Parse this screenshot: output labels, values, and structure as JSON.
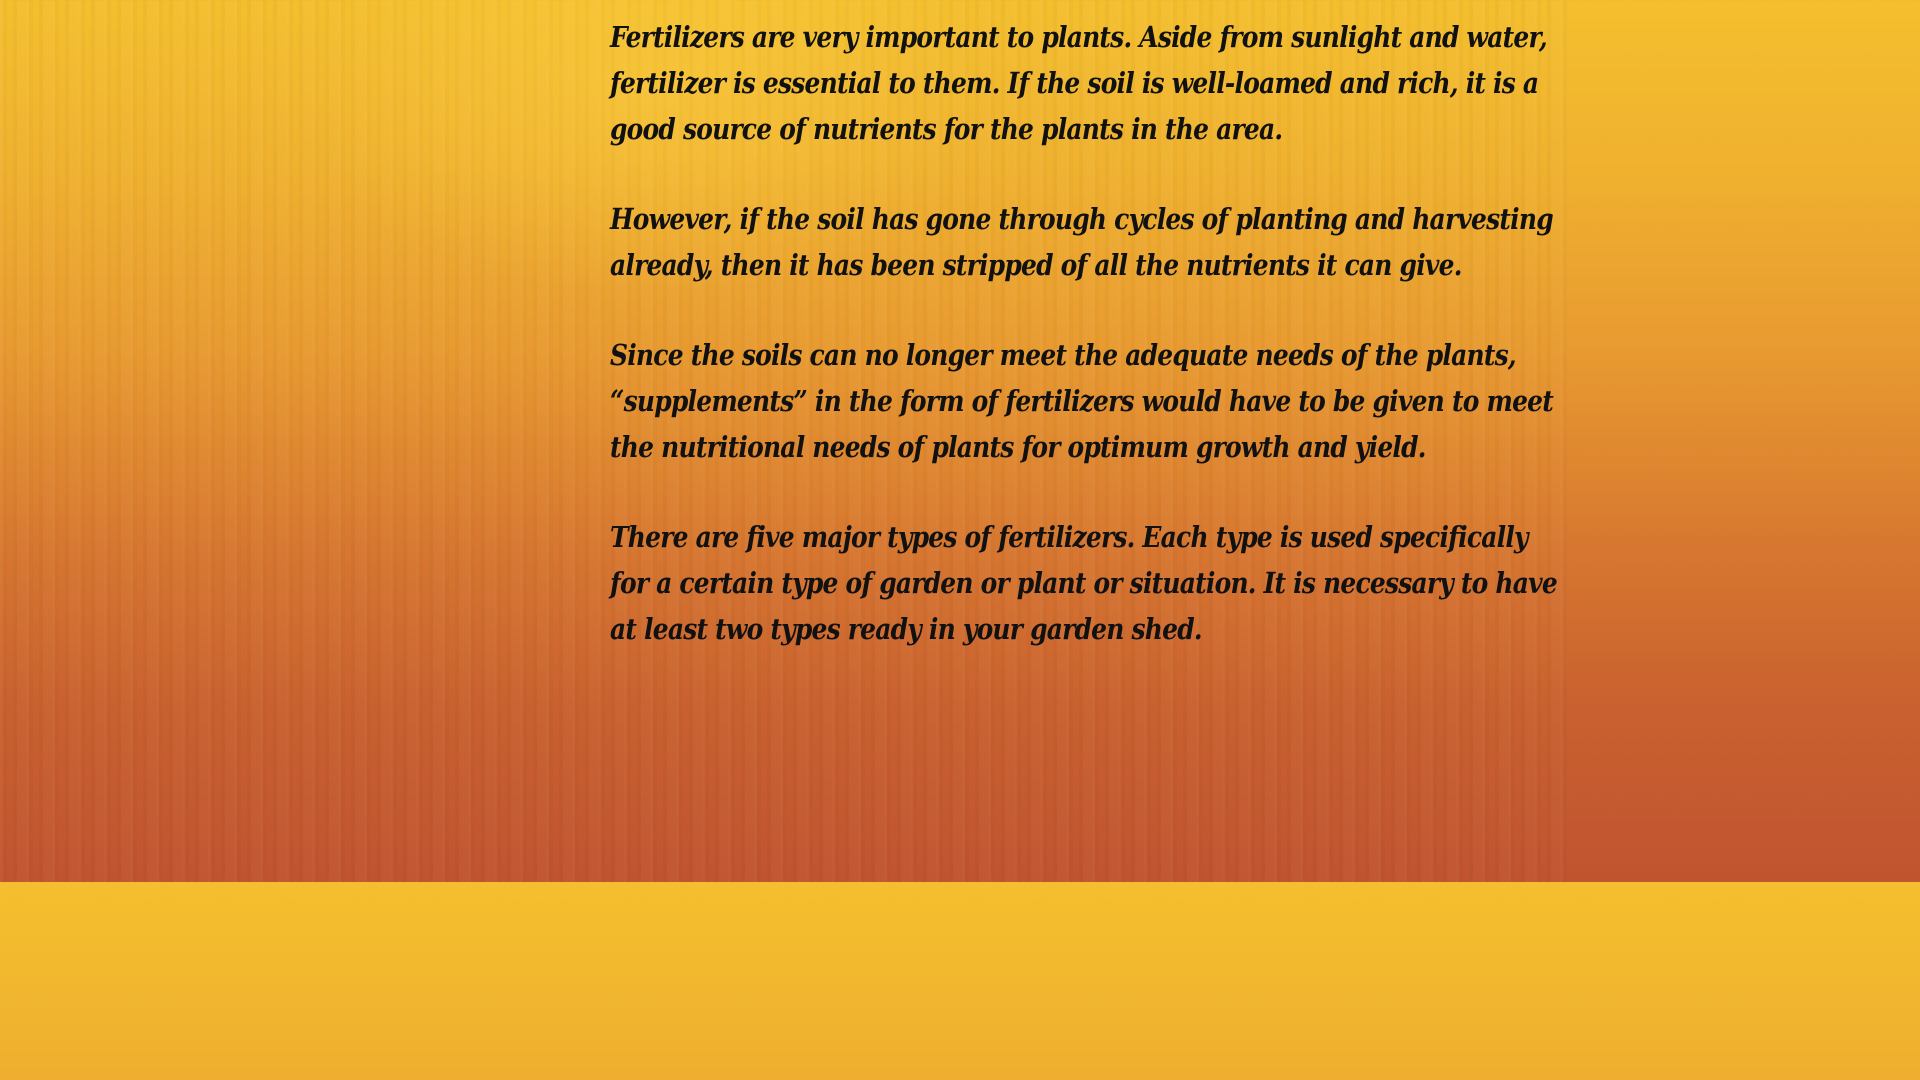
{
  "paragraphs": [
    "Fertilizers are very important to plants. Aside from sunlight and water, fertilizer is essential to them. If the soil is well-loamed and rich, it is a good source of nutrients for the plants in the area.",
    "However, if the soil has gone through cycles of planting and harvesting already, then it has been stripped of all the nutrients it can give.",
    "Since the soils can no longer meet the adequate needs of the plants, “supplements” in the form of fertilizers would have to be given to meet the nutritional needs of plants for optimum growth and yield.",
    "There are five major types of fertilizers. Each type is used specifically for a certain type of garden or plant or situation. It is necessary to have at least two types ready in your garden shed."
  ],
  "colors": {
    "background_top": "#f4bf2e",
    "background_bottom": "#c05430",
    "text": "#111111"
  }
}
